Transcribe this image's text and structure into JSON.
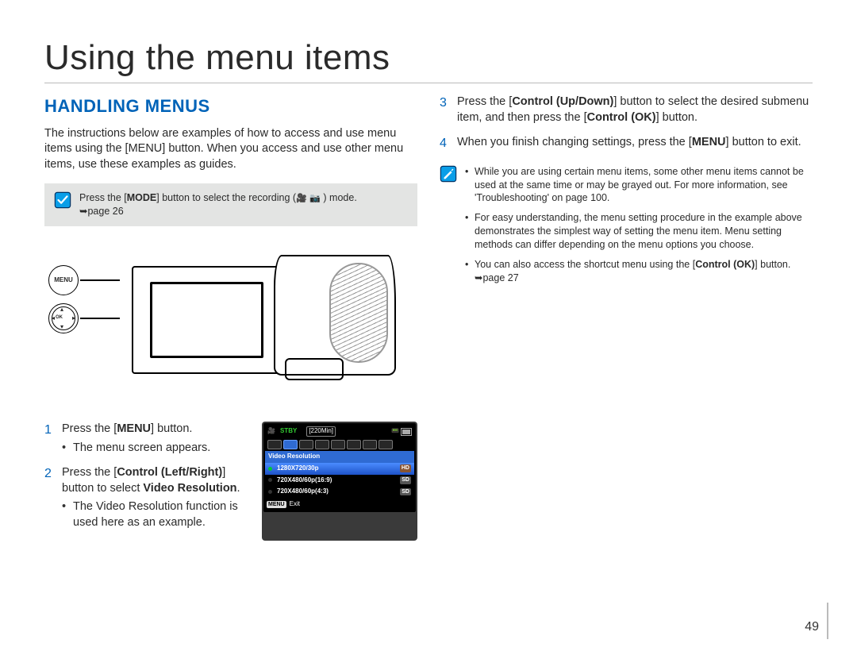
{
  "page": {
    "title": "Using the menu items",
    "number": "49"
  },
  "left": {
    "heading": "HANDLING MENUS",
    "intro": "The instructions below are examples of how to access and use menu items using the [MENU] button. When you access and use other menu items, use these examples as guides.",
    "graybox": {
      "line1_pre": "Press the [",
      "line1_mode": "MODE",
      "line1_mid": "] button to select the recording (",
      "line1_post": " ) mode.",
      "line2": "➥page 26"
    },
    "diagram": {
      "menu_label": "MENU",
      "ok_label": "OK"
    },
    "steps": [
      {
        "text_pre": "Press the [",
        "text_bold": "MENU",
        "text_post": "] button.",
        "sub": [
          "The menu screen appears."
        ]
      },
      {
        "text_pre": "Press the [",
        "text_bold": "Control (Left/Right)",
        "text_post": "] button to select ",
        "text_bold2": "Video Resolution",
        "text_post2": ".",
        "sub": [
          "The Video Resolution function is used here as an example."
        ]
      }
    ]
  },
  "lcd": {
    "stby": "STBY",
    "time": "[220Min]",
    "section": "Video Resolution",
    "rows": [
      {
        "label": "1280X720/30p",
        "badge": "HD",
        "selected": true
      },
      {
        "label": "720X480/60p(16:9)",
        "badge": "SD",
        "selected": false
      },
      {
        "label": "720X480/60p(4:3)",
        "badge": "SD",
        "selected": false
      }
    ],
    "foot_menu": "MENU",
    "foot_exit": "Exit"
  },
  "right": {
    "steps": [
      {
        "num": "3",
        "text_pre": "Press the [",
        "text_bold": "Control (Up/Down)",
        "text_mid": "] button to select the desired submenu item, and then press the [",
        "text_bold2": "Control (OK)",
        "text_post": "] button."
      },
      {
        "num": "4",
        "text_pre": "When you finish changing settings, press the [",
        "text_bold": "MENU",
        "text_post": "] button to exit."
      }
    ],
    "notes": [
      "While you are using certain menu items, some other menu items cannot be used at the same time or may be grayed out. For more information, see 'Troubleshooting' on page 100.",
      "For easy understanding, the menu setting procedure in the example above demonstrates the simplest way of setting the menu item. Menu setting methods can differ depending on the menu options you choose."
    ],
    "note3": {
      "pre": "You can also access the shortcut menu using the [",
      "bold": "Control (OK)",
      "post": "] button. ➥page 27"
    }
  }
}
